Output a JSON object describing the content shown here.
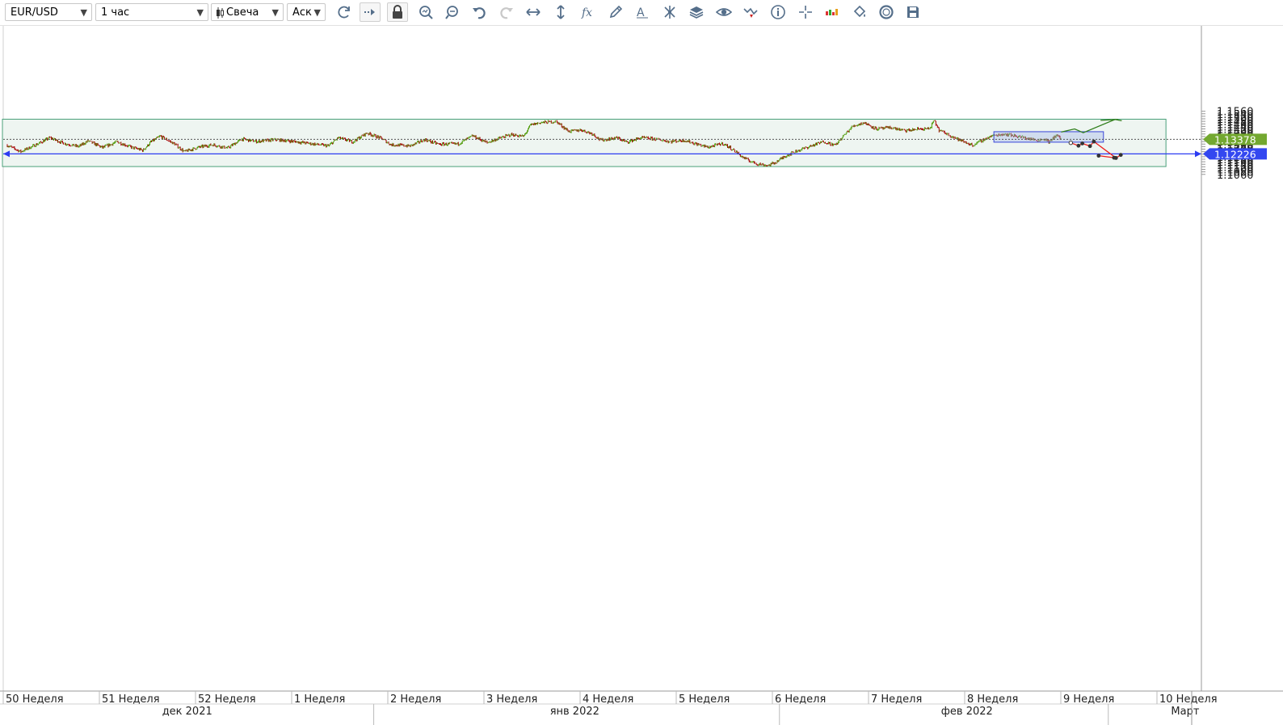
{
  "toolbar": {
    "symbol": "EUR/USD",
    "timeframe": "1 час",
    "chart_type": "Свеча",
    "price_side": "Аск",
    "tools": [
      "refresh-icon",
      "autoscroll-icon",
      "lock-icon",
      "zoom-in-icon",
      "zoom-out-icon",
      "undo-icon",
      "redo-icon",
      "fit-horizontal-icon",
      "fit-vertical-icon",
      "indicators-icon",
      "draw-icon",
      "text-tool-icon",
      "crosshair-icon",
      "layers-icon",
      "eye-icon",
      "signals-icon",
      "info-icon",
      "cursor-cross-icon",
      "volume-icon",
      "color-fill-icon",
      "theme-icon",
      "save-icon"
    ]
  },
  "chart_data": {
    "type": "candlestick",
    "symbol": "EUR/USD",
    "ylim": [
      1.1045,
      1.1575
    ],
    "yticks": [
      "1.1560",
      "1.1540",
      "1.1520",
      "1.1500",
      "1.1480",
      "1.1460",
      "1.1440",
      "1.1420",
      "1.1400",
      "1.1380",
      "1.1360",
      "1.1340",
      "1.1320",
      "1.1300",
      "1.1280",
      "1.1260",
      "1.1240",
      "1.1220",
      "1.1200",
      "1.1180",
      "1.1160",
      "1.1140",
      "1.1120",
      "1.1100",
      "1.1080",
      "1.1060"
    ],
    "xlim": [
      0,
      12.0
    ],
    "week_labels": [
      {
        "x": 0.0,
        "label": "50 Неделя"
      },
      {
        "x": 1.0,
        "label": "51 Неделя"
      },
      {
        "x": 2.0,
        "label": "52 Неделя"
      },
      {
        "x": 3.0,
        "label": "1 Неделя"
      },
      {
        "x": 4.0,
        "label": "2 Неделя"
      },
      {
        "x": 5.0,
        "label": "3 Неделя"
      },
      {
        "x": 6.0,
        "label": "4 Неделя"
      },
      {
        "x": 7.0,
        "label": "5 Неделя"
      },
      {
        "x": 8.0,
        "label": "6 Неделя"
      },
      {
        "x": 9.0,
        "label": "7 Неделя"
      },
      {
        "x": 10.0,
        "label": "8 Неделя"
      },
      {
        "x": 11.0,
        "label": "9 Неделя"
      },
      {
        "x": 12.0,
        "label": "10 Неделя"
      }
    ],
    "month_labels": [
      {
        "x": 1.88,
        "label": "дек 2021"
      },
      {
        "x": 5.91,
        "label": "янв 2022"
      },
      {
        "x": 9.99,
        "label": "фев 2022"
      },
      {
        "x": 12.26,
        "label": "Март"
      }
    ],
    "month_dividers": [
      3.82,
      8.04,
      11.46
    ],
    "price_path": [
      [
        0.0,
        1.1292
      ],
      [
        0.15,
        1.124
      ],
      [
        0.35,
        1.131
      ],
      [
        0.45,
        1.135
      ],
      [
        0.6,
        1.1305
      ],
      [
        0.75,
        1.128
      ],
      [
        0.85,
        1.1325
      ],
      [
        1.0,
        1.1272
      ],
      [
        1.15,
        1.1318
      ],
      [
        1.3,
        1.1275
      ],
      [
        1.42,
        1.125
      ],
      [
        1.5,
        1.1315
      ],
      [
        1.6,
        1.1362
      ],
      [
        1.75,
        1.13
      ],
      [
        1.85,
        1.124
      ],
      [
        2.0,
        1.1275
      ],
      [
        2.15,
        1.1295
      ],
      [
        2.3,
        1.1268
      ],
      [
        2.45,
        1.134
      ],
      [
        2.6,
        1.132
      ],
      [
        2.8,
        1.1335
      ],
      [
        3.0,
        1.132
      ],
      [
        3.2,
        1.13
      ],
      [
        3.35,
        1.1285
      ],
      [
        3.45,
        1.135
      ],
      [
        3.6,
        1.1318
      ],
      [
        3.75,
        1.1388
      ],
      [
        3.9,
        1.1345
      ],
      [
        4.0,
        1.1295
      ],
      [
        4.2,
        1.1285
      ],
      [
        4.35,
        1.1335
      ],
      [
        4.5,
        1.1298
      ],
      [
        4.7,
        1.1302
      ],
      [
        4.85,
        1.1365
      ],
      [
        5.0,
        1.131
      ],
      [
        5.1,
        1.134
      ],
      [
        5.25,
        1.1375
      ],
      [
        5.38,
        1.136
      ],
      [
        5.45,
        1.145
      ],
      [
        5.55,
        1.147
      ],
      [
        5.72,
        1.1478
      ],
      [
        5.85,
        1.14
      ],
      [
        5.98,
        1.1412
      ],
      [
        6.1,
        1.138
      ],
      [
        6.18,
        1.133
      ],
      [
        6.35,
        1.135
      ],
      [
        6.45,
        1.1315
      ],
      [
        6.6,
        1.135
      ],
      [
        6.75,
        1.134
      ],
      [
        6.9,
        1.132
      ],
      [
        7.05,
        1.133
      ],
      [
        7.2,
        1.1295
      ],
      [
        7.3,
        1.1275
      ],
      [
        7.45,
        1.1305
      ],
      [
        7.55,
        1.126
      ],
      [
        7.65,
        1.12
      ],
      [
        7.72,
        1.117
      ],
      [
        7.8,
        1.1145
      ],
      [
        7.92,
        1.113
      ],
      [
        8.0,
        1.1155
      ],
      [
        8.1,
        1.1205
      ],
      [
        8.2,
        1.124
      ],
      [
        8.35,
        1.128
      ],
      [
        8.5,
        1.132
      ],
      [
        8.62,
        1.129
      ],
      [
        8.7,
        1.136
      ],
      [
        8.8,
        1.144
      ],
      [
        8.92,
        1.147
      ],
      [
        9.05,
        1.142
      ],
      [
        9.2,
        1.143
      ],
      [
        9.35,
        1.1405
      ],
      [
        9.5,
        1.142
      ],
      [
        9.6,
        1.142
      ],
      [
        9.65,
        1.1485
      ],
      [
        9.7,
        1.141
      ],
      [
        9.8,
        1.1375
      ],
      [
        9.92,
        1.133
      ],
      [
        10.05,
        1.129
      ],
      [
        10.15,
        1.133
      ],
      [
        10.25,
        1.1365
      ],
      [
        10.38,
        1.138
      ],
      [
        10.5,
        1.1365
      ],
      [
        10.62,
        1.1345
      ],
      [
        10.72,
        1.133
      ],
      [
        10.8,
        1.134
      ],
      [
        10.85,
        1.1315
      ],
      [
        10.92,
        1.1375
      ],
      [
        10.97,
        1.1338
      ]
    ],
    "support_line": {
      "y": 1.12226,
      "label": "1.12226"
    },
    "last_price": {
      "y": 1.13378,
      "label": "1.13378"
    },
    "range_box": {
      "x1": 0.0,
      "x2": 12.06,
      "y1": 1.1122,
      "y2": 1.1497
    },
    "consolidation_box": {
      "x1": 10.27,
      "x2": 11.41,
      "y1": 1.1315,
      "y2": 1.1398
    },
    "bull_path": [
      [
        10.97,
        1.1395
      ],
      [
        11.11,
        1.142
      ],
      [
        11.2,
        1.139
      ],
      [
        11.53,
        1.1495
      ],
      [
        11.6,
        1.1485
      ]
    ],
    "bull_arrow_head": [
      [
        11.38,
        1.1488
      ],
      [
        11.56,
        1.1495
      ]
    ],
    "bear_path": [
      [
        11.07,
        1.131
      ],
      [
        11.15,
        1.1287
      ],
      [
        11.19,
        1.1305
      ],
      [
        11.27,
        1.1284
      ],
      [
        11.31,
        1.132
      ],
      [
        11.54,
        1.119
      ],
      [
        11.59,
        1.1214
      ]
    ],
    "bear_tail": [
      [
        11.36,
        1.1208
      ],
      [
        11.52,
        1.1192
      ]
    ]
  }
}
